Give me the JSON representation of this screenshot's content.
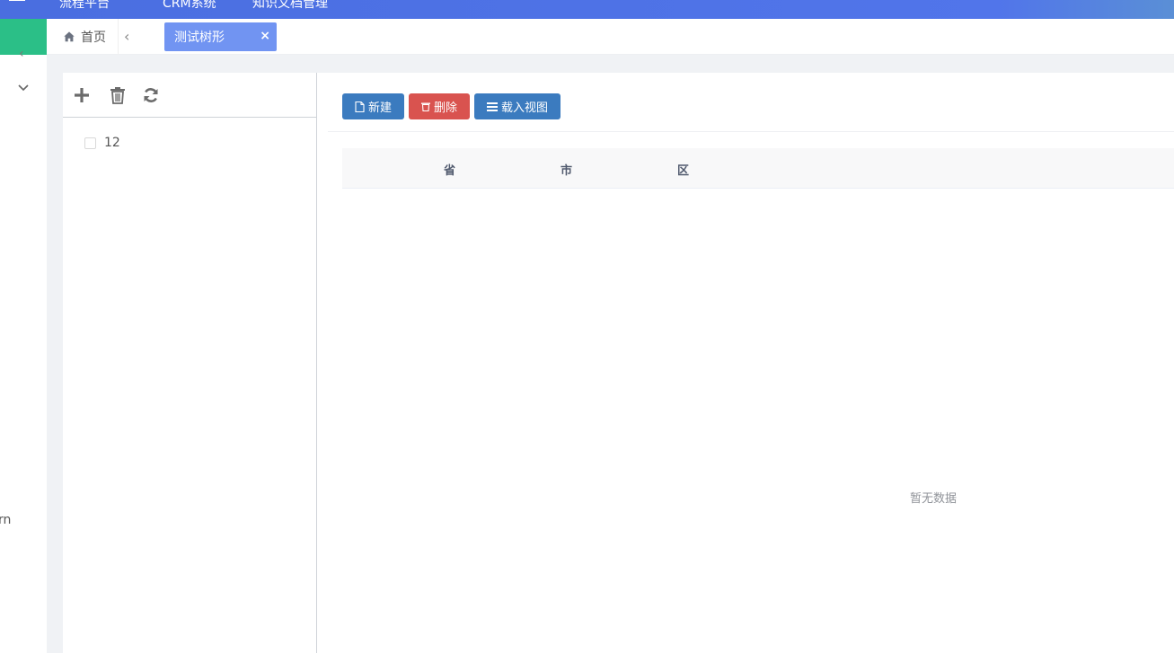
{
  "topbar": {
    "nav_items": [
      "流程平台",
      "CRM系统",
      "知识文档管理"
    ]
  },
  "sidebar": {
    "cut_text": "rn"
  },
  "tabs": {
    "home_label": "首页",
    "active_label": "测试树形",
    "close_glyph": "×"
  },
  "tree": {
    "nodes": [
      {
        "label": "12"
      }
    ]
  },
  "toolbar": {
    "new_label": "新建",
    "delete_label": "删除",
    "load_view_label": "载入视图"
  },
  "table": {
    "columns": [
      "省",
      "市",
      "区"
    ],
    "empty_text": "暂无数据"
  },
  "colors": {
    "header_gradient_start": "#4a6ee0",
    "sidebar_accent": "#2bbf87",
    "active_tab": "#7194f2",
    "primary_button": "#3b7bbf",
    "danger_button": "#d9534f"
  }
}
